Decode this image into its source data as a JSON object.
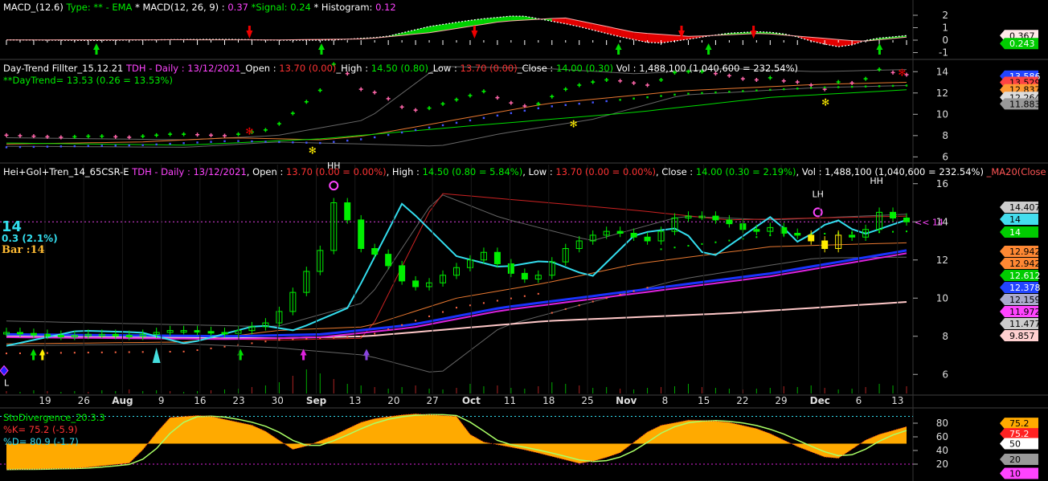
{
  "colors": {
    "bg": "#000000",
    "divider": "#404040",
    "dotted": "#e040e0",
    "green": "#00dd00",
    "red": "#ee0000",
    "cyan": "#33ddee",
    "blue": "#1a33ff",
    "magenta": "#dd22dd",
    "pink": "#ffc8c8",
    "orange": "#e87830",
    "yellow": "#ffee00",
    "gray": "#9a9a9a"
  },
  "macd_panel": {
    "name": "MACD_(12.6)",
    "type_label": "Type: ** - EMA",
    "macd_label": "* MACD(12, 26, 9) :",
    "macd_value": "0.37",
    "signal_label": "*Signal:",
    "signal_value": "0.24",
    "hist_label": "* Histogram:",
    "hist_value": "0.12",
    "axis_ticks": [
      "2",
      "1",
      "0",
      "-1"
    ],
    "tags": [
      "0.367",
      "0.243"
    ]
  },
  "trend_panel": {
    "name": "Day-Trend Fillter_15.12.21",
    "symbol": "TDH - Daily : 13/12/2021",
    "open_label": "_Open :",
    "open_value": "13.70 (0.00)",
    "high_label": "_High :",
    "high_value": "14.50 (0.80)",
    "low_label": "_Low :",
    "low_value": "13.70 (0.00)",
    "close_label": "_Close :",
    "close_value": "14.00",
    "close_change": "(0.30)",
    "vol_label": "Vol :",
    "vol_value": "1,488,100 (1,040,600 = 232.54%)",
    "daytrend": "**DayTrend= 13.53 (0.26 = 13.53%)",
    "axis_ticks": [
      "14",
      "12",
      "10",
      "8",
      "6"
    ],
    "tags": [
      "13.586",
      "13.529",
      "12.837",
      "12.264",
      "11.883"
    ]
  },
  "price_panel": {
    "name": "Hei+Gol+Tren_14_65CSR-E",
    "symbol": "TDH - Daily : 13/12/2021",
    "open_label": ", Open :",
    "open_value": "13.70 (0.00 = 0.00%)",
    "high_label": ", High :",
    "high_value": "14.50 (0.80 = 5.84%)",
    "low_label": ", Low :",
    "low_value": "13.70 (0.00 = 0.00%)",
    "close_label": ", Close :",
    "close_value": "14.00 (0.30 = 2.19%)",
    "vol_label": ", Vol :",
    "vol_value": "1,488,100 (1,040,600 = 232.54%)",
    "ma_label": "_MA20(Close",
    "price_big": "14",
    "change": "0.3 (2.1%)",
    "bar": "Bar :14",
    "last_marker": "<< 14",
    "axis_ticks": [
      "16",
      "14",
      "12",
      "10",
      "8",
      "6"
    ],
    "tags": [
      "14.407",
      "14",
      "14",
      "12.942",
      "12.942",
      "12.612",
      "12.378",
      "12.159",
      "11.972",
      "11.477",
      "9.857"
    ],
    "annotations": [
      "HH",
      "LH",
      "HH"
    ],
    "low_label_text": "L",
    "dates": [
      "19",
      "26",
      "Aug",
      "9",
      "16",
      "23",
      "30",
      "Sep",
      "13",
      "20",
      "27",
      "Oct",
      "11",
      "18",
      "25",
      "Nov",
      "8",
      "15",
      "22",
      "29",
      "Dec",
      "6",
      "13"
    ]
  },
  "sto_panel": {
    "name": "StoDivergence_20.3.3",
    "k_label": "%K= 75.2 (-5.9)",
    "d_label": "%D= 80.9 (-1.7)",
    "axis_ticks": [
      "80",
      "60",
      "40",
      "20"
    ],
    "tags": [
      "75.2",
      "75.2",
      "50",
      "20",
      "10"
    ]
  },
  "chart_data": {
    "type": "line",
    "title": "Hei+Gol+Tren_14_65CSR-E",
    "symbol": "TDH - Daily",
    "x_range": [
      "19 Jul 2021",
      "13 Dec 2021"
    ],
    "ylim": [
      5,
      17
    ],
    "series": [
      {
        "name": "Close",
        "values": [
          8.2,
          8.15,
          8.1,
          8.05,
          8.0,
          8.05,
          8.1,
          8.1,
          8.05,
          8.0,
          8.1,
          8.2,
          8.3,
          8.3,
          8.25,
          8.2,
          8.15,
          8.3,
          8.5,
          8.7,
          9.3,
          10.3,
          11.4,
          12.5,
          15.0,
          14.1,
          12.6,
          12.3,
          11.7,
          10.9,
          10.6,
          10.8,
          11.2,
          11.6,
          12.0,
          12.4,
          11.8,
          11.3,
          11.0,
          11.2,
          11.9,
          12.6,
          13.0,
          13.3,
          13.5,
          13.4,
          13.2,
          13.0,
          13.5,
          14.2,
          14.3,
          14.3,
          14.1,
          13.9,
          13.6,
          13.5,
          13.7,
          13.4,
          13.3,
          13.0,
          12.6,
          13.3,
          13.2,
          13.6,
          14.5,
          14.2,
          14.0
        ]
      }
    ]
  }
}
